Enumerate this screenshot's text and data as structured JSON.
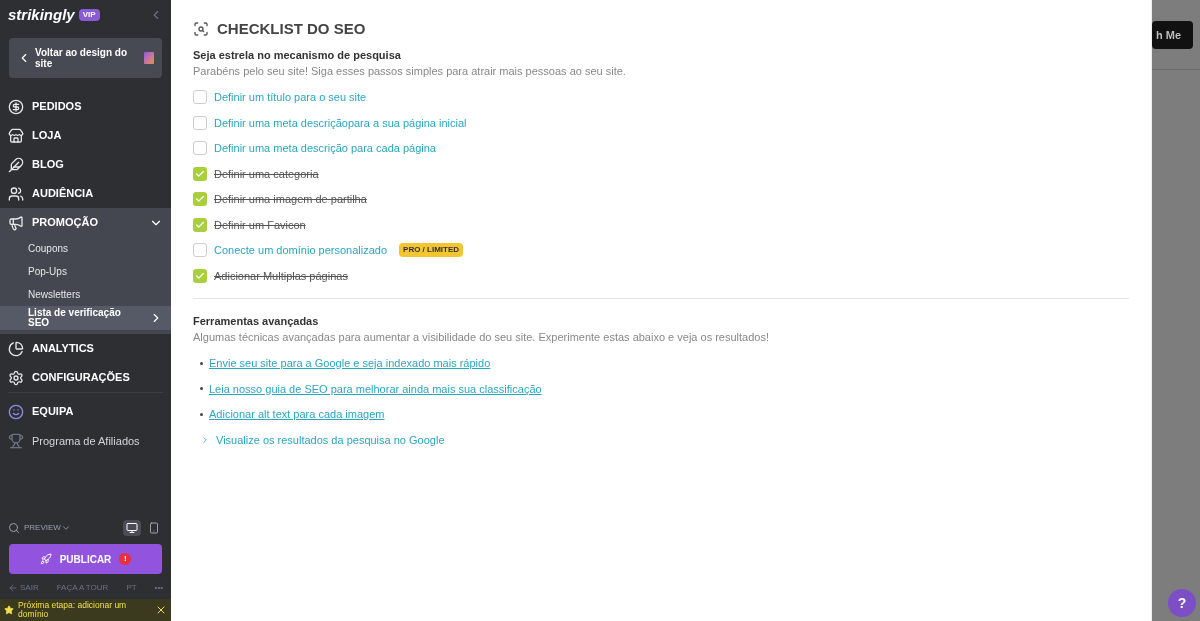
{
  "sidebar": {
    "logo": "strikingly",
    "badge": "VIP",
    "back_button": "Voltar ao design do site",
    "nav": [
      {
        "label": "PEDIDOS",
        "kind": "main"
      },
      {
        "label": "LOJA",
        "kind": "main"
      },
      {
        "label": "BLOG",
        "kind": "main"
      },
      {
        "label": "AUDIÊNCIA",
        "kind": "main"
      },
      {
        "label": "PROMOÇÃO",
        "kind": "main",
        "expanded": true,
        "children": [
          {
            "label": "Coupons",
            "selected": false
          },
          {
            "label": "Pop-Ups",
            "selected": false
          },
          {
            "label": "Newsletters",
            "selected": false
          },
          {
            "label": "Lista de verificação SEO",
            "selected": true
          }
        ]
      },
      {
        "label": "ANALYTICS",
        "kind": "main"
      },
      {
        "label": "CONFIGURAÇÕES",
        "kind": "main"
      },
      {
        "label": "EQUIPA",
        "kind": "team"
      },
      {
        "label": "Programa de Afiliados",
        "kind": "plain"
      }
    ],
    "preview": "PREVIEW",
    "devices": [
      {
        "selected": true
      },
      {
        "selected": false
      }
    ],
    "publish": "PUBLICAR",
    "publish_alert": "!",
    "footer_links": [
      "SAIR",
      "FAÇA A TOUR",
      "PT",
      "•••"
    ],
    "notification": "Próxima etapa: adicionar um domínio"
  },
  "main": {
    "title": "CHECKLIST DO SEO",
    "subtitle": "Seja estrela no mecanismo de pesquisa",
    "description": "Parabéns pelo seu site! Siga esses passos simples para atrair mais pessoas ao seu site.",
    "checklist": [
      {
        "label": "Definir um título para o seu site",
        "checked": false
      },
      {
        "label": "Definir uma meta descriçãopara a sua página inicial",
        "checked": false
      },
      {
        "label": "Definir uma meta descrição para cada página",
        "checked": false
      },
      {
        "label": "Definir uma categoria",
        "checked": true
      },
      {
        "label": "Definir uma imagem de partilha",
        "checked": true
      },
      {
        "label": "Definir um Favicon",
        "checked": true
      },
      {
        "label": "Conecte um domínio personalizado",
        "checked": false,
        "badge": "PRO / LIMITED"
      },
      {
        "label": "Adicionar Multiplas páginas",
        "checked": true
      }
    ],
    "advanced": {
      "title": "Ferramentas avançadas",
      "description": "Algumas técnicas avançadas para aumentar a visibilidade do seu site. Experimente estas abaixo e veja os resultados!",
      "links": [
        {
          "label": "Envie seu site para a Google e seja indexado mais rápido",
          "kind": "bullet"
        },
        {
          "label": "Leia nosso guia de SEO para melhorar ainda mais sua classificação",
          "kind": "bullet"
        },
        {
          "label": "Adicionar alt text para cada imagem",
          "kind": "bullet"
        },
        {
          "label": "Visualize os resultados da pesquisa no Google",
          "kind": "expand"
        }
      ]
    }
  },
  "background": {
    "button": "h Me",
    "help": "?"
  }
}
